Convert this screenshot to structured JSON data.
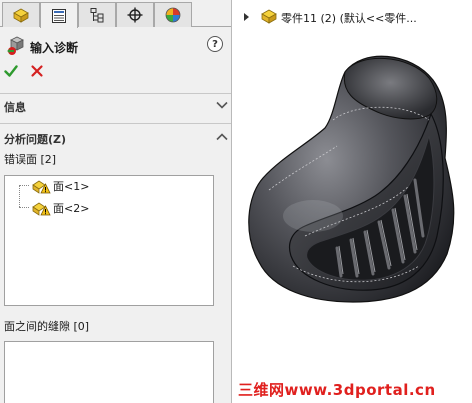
{
  "tabs": [
    {
      "name": "feature-manager-tab",
      "icon": "feature-manager-icon"
    },
    {
      "name": "property-manager-tab",
      "icon": "property-manager-icon",
      "active": true
    },
    {
      "name": "configuration-manager-tab",
      "icon": "configuration-manager-icon"
    },
    {
      "name": "dimxpert-manager-tab",
      "icon": "crosshair-icon"
    },
    {
      "name": "display-manager-tab",
      "icon": "appearance-icon"
    }
  ],
  "property_manager": {
    "title": "输入诊断",
    "help": "?",
    "ok_icon": "checkmark-icon",
    "cancel_icon": "cross-icon"
  },
  "groups": {
    "info": {
      "title": "信息",
      "expanded": false
    },
    "analyze": {
      "title": "分析问题(Z)",
      "expanded": true
    }
  },
  "faulty_faces": {
    "label": "错误面 [2]",
    "items": [
      "面<1>",
      "面<2>"
    ]
  },
  "gaps": {
    "label": "面之间的缝隙 [0]",
    "items": []
  },
  "graphics": {
    "tree_title": "零件11 (2)  (默认<<零件...",
    "watermark": "三维网www.3dportal.cn"
  },
  "colors": {
    "accent_green": "#2e9a2e",
    "cancel_red": "#d42020",
    "warning_yellow": "#f2c21a",
    "watermark_red": "#e0201e"
  }
}
